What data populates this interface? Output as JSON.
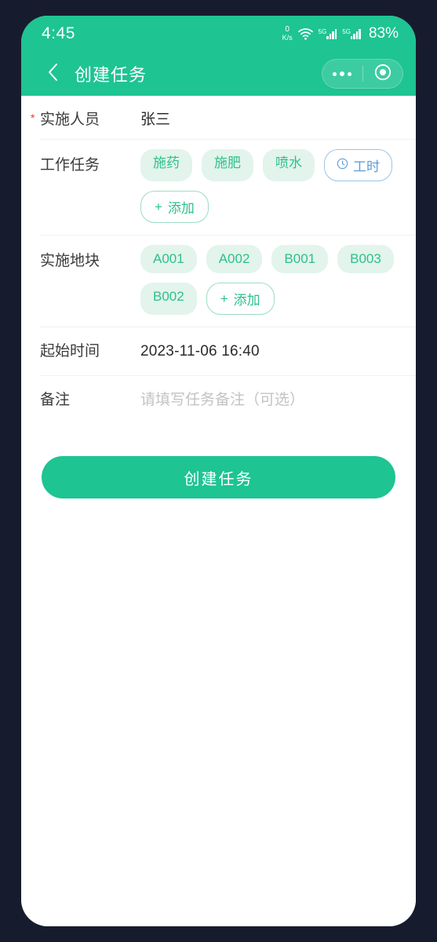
{
  "status_bar": {
    "time": "4:45",
    "net_speed_value": "0",
    "net_speed_unit": "K/s",
    "wifi_icon": "wifi-icon",
    "signal_1_label": "5G",
    "signal_2_label": "5G",
    "battery": "83%"
  },
  "nav": {
    "back_icon": "back-chevron-icon",
    "title": "创建任务",
    "menu_icon": "more-dots-icon",
    "close_icon": "target-circle-icon"
  },
  "form": {
    "person": {
      "required_mark": "*",
      "label": "实施人员",
      "value": "张三"
    },
    "task": {
      "label": "工作任务",
      "tags": [
        "施药",
        "施肥",
        "喷水"
      ],
      "hours_tag": {
        "icon": "clock-icon",
        "label": "工时"
      },
      "add_button": {
        "plus": "+",
        "label": "添加"
      }
    },
    "plot": {
      "label": "实施地块",
      "tags": [
        "A001",
        "A002",
        "B001",
        "B003",
        "B002"
      ],
      "add_button": {
        "plus": "+",
        "label": "添加"
      }
    },
    "start_time": {
      "label": "起始时间",
      "value": "2023-11-06 16:40"
    },
    "remark": {
      "label": "备注",
      "placeholder": "请填写任务备注（可选）"
    }
  },
  "submit": {
    "label": "创建任务"
  },
  "colors": {
    "brand_green": "#1ec492",
    "tag_green_bg": "#e2f4ec",
    "tag_green_text": "#2ec08b",
    "hours_blue": "#5a9ddb",
    "required_red": "#e8353a",
    "frame_dark": "#161c2e"
  }
}
